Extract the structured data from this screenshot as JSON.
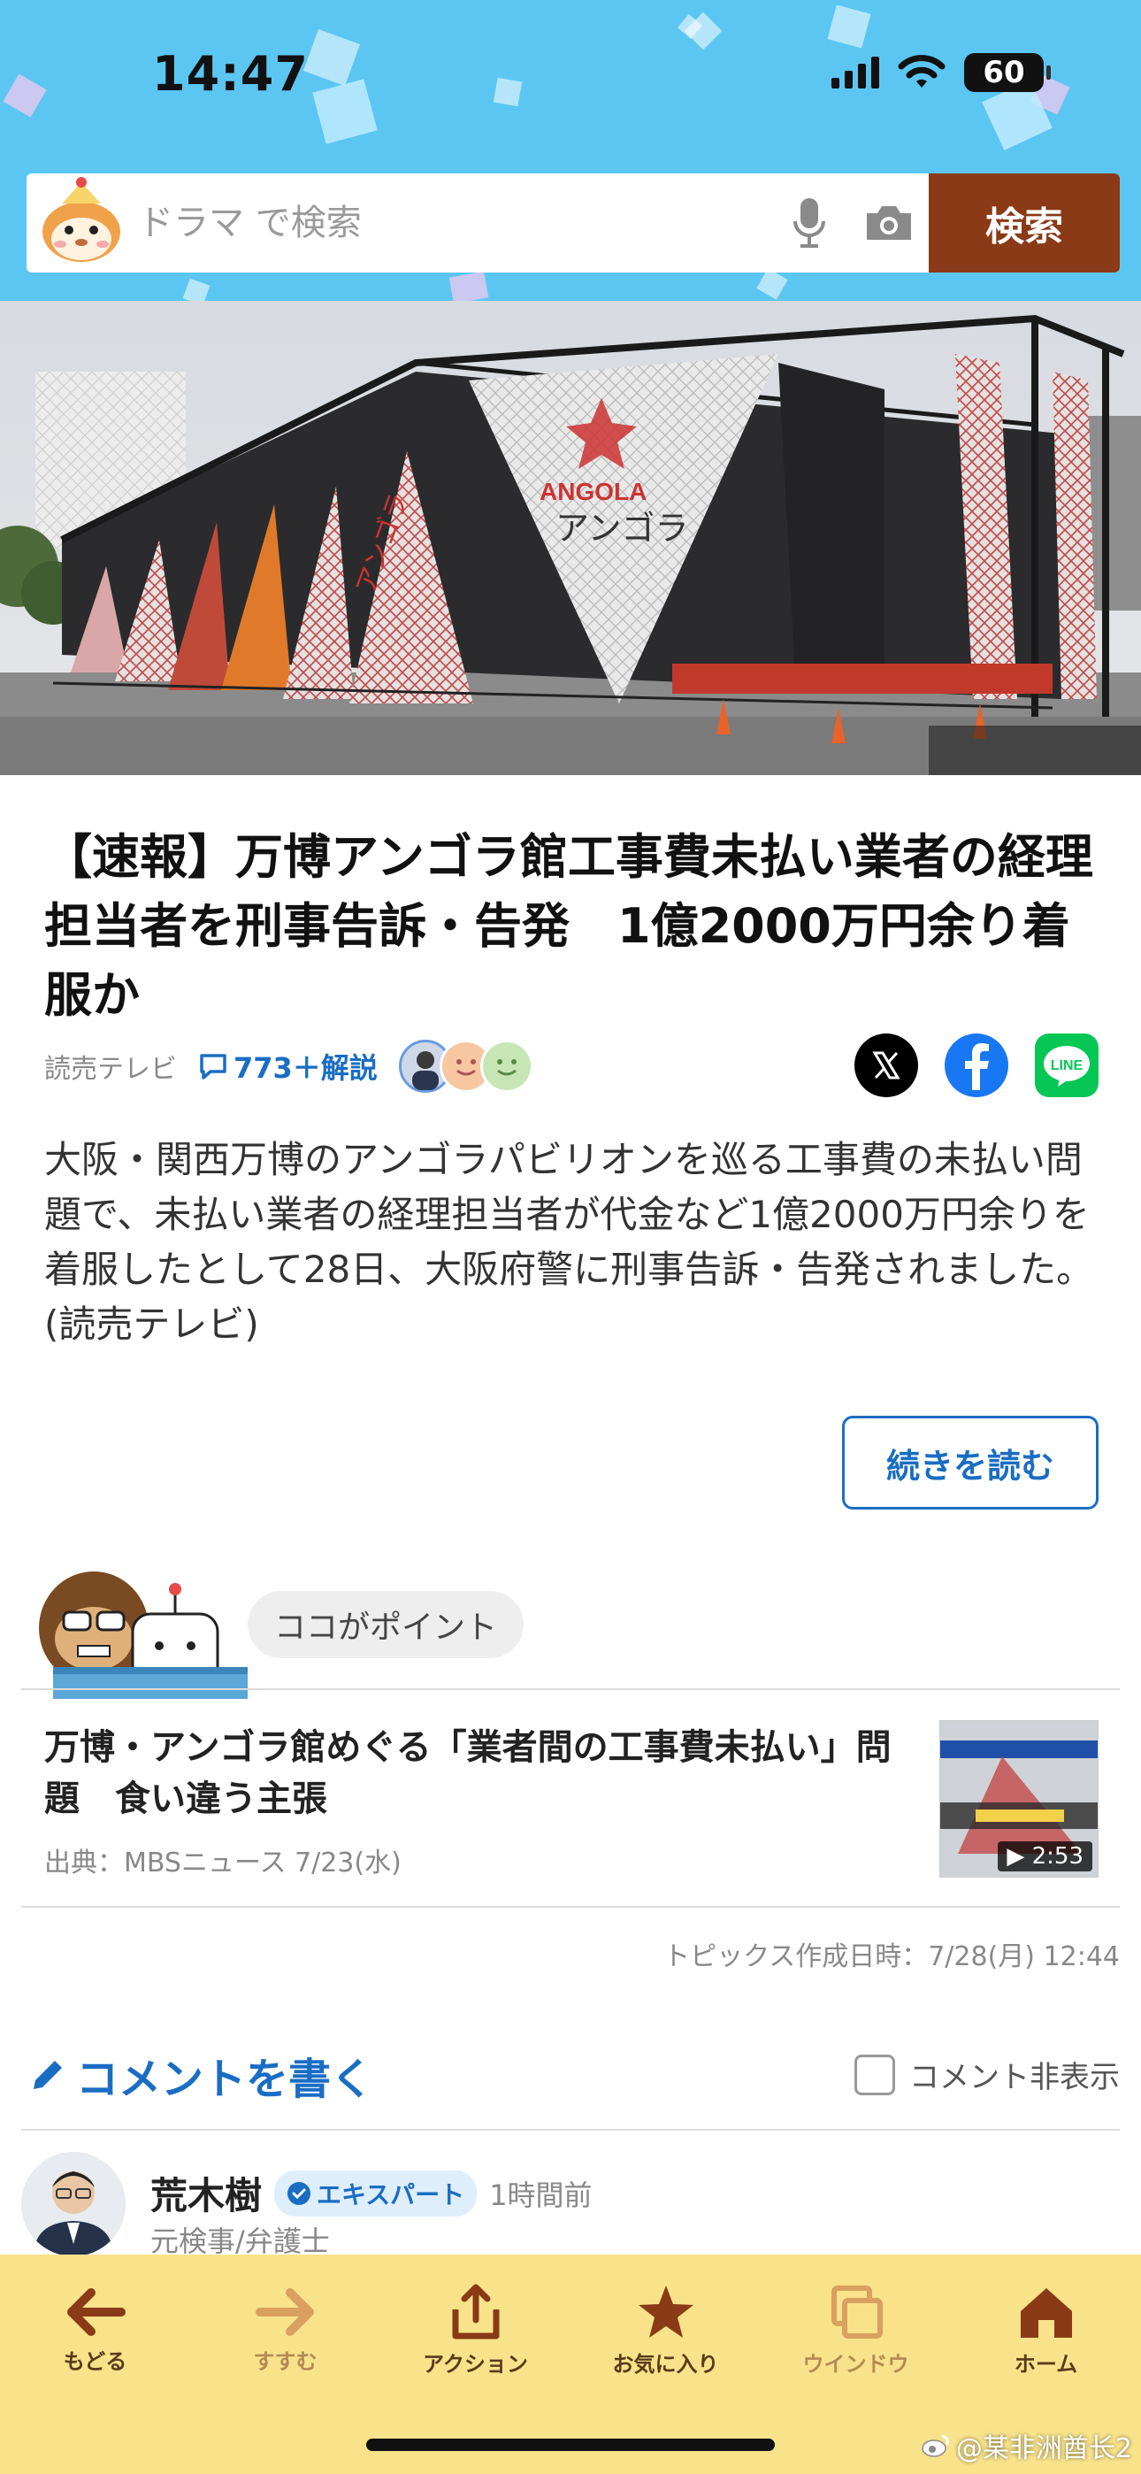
{
  "status_bar": {
    "time": "14:47",
    "battery": "60"
  },
  "search": {
    "placeholder": "ドラマ で検索",
    "button_label": "検索"
  },
  "article": {
    "headline": "【速報】万博アンゴラ館工事費未払い業者の経理担当者を刑事告訴・告発　1億2000万円余り着服か",
    "source": "読売テレビ",
    "comment_count": "773＋解説",
    "summary": "大阪・関西万博のアンゴラパビリオンを巡る工事費の未払い問題で、未払い業者の経理担当者が代金など1億2000万円余りを着服したとして28日、大阪府警に刑事告訴・告発されました。(読売テレビ)",
    "read_more": "続きを読む"
  },
  "hero": {
    "sign_latin": "ANGOLA",
    "sign_kana": "アンゴラ",
    "side_kana": "アンゴラ"
  },
  "point": {
    "bubble": "ココがポイント",
    "related_title": "万博・アンゴラ館めぐる「業者間の工事費未払い」問題　食い違う主張",
    "related_source": "出典：MBSニュース  7/23(水)",
    "video_duration": "2:53",
    "created_at": "トピックス作成日時：7/28(月) 12:44"
  },
  "comments": {
    "write_label": "コメントを書く",
    "hide_label": "コメント非表示",
    "first": {
      "name": "荒木樹",
      "badge": "エキスパート",
      "time": "1時間前",
      "title": "元検事/弁護士"
    }
  },
  "toolbar": {
    "items": [
      {
        "label": "もどる",
        "icon": "arrow-left-icon"
      },
      {
        "label": "すすむ",
        "icon": "arrow-right-icon"
      },
      {
        "label": "アクション",
        "icon": "share-icon"
      },
      {
        "label": "お気に入り",
        "icon": "star-icon"
      },
      {
        "label": "ウインドウ",
        "icon": "windows-icon"
      },
      {
        "label": "ホーム",
        "icon": "home-icon"
      }
    ]
  },
  "watermark": "@某非洲酋长2",
  "colors": {
    "header": "#5cc6f2",
    "search_button": "#8a3a16",
    "link": "#1a6dc3",
    "toolbar": "#f8e38a"
  }
}
